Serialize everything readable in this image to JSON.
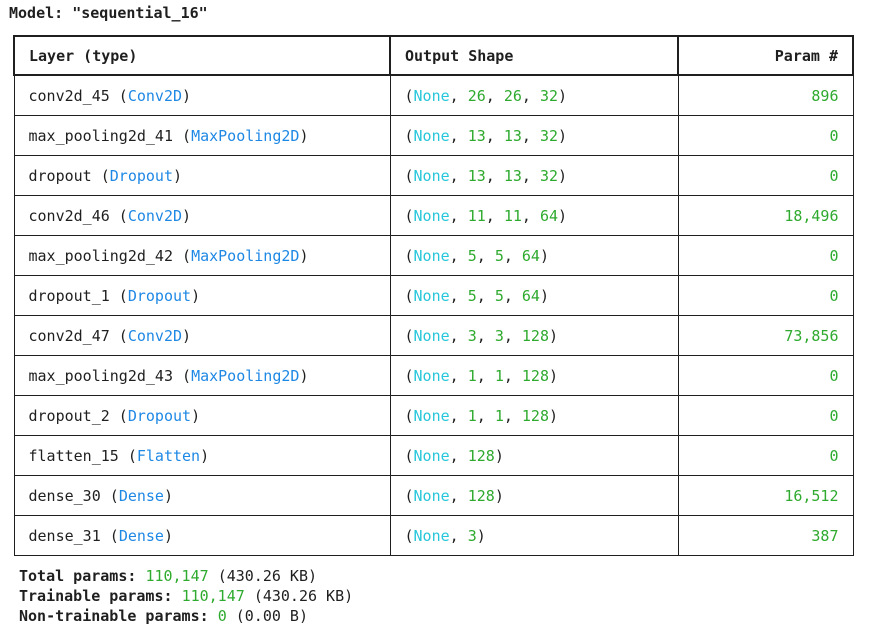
{
  "model": {
    "title": "Model: \"sequential_16\""
  },
  "table": {
    "headers": {
      "layer": "Layer (type)",
      "shape": "Output Shape",
      "params": "Param #"
    },
    "rows": [
      {
        "name": "conv2d_45",
        "type": "Conv2D",
        "shape": [
          "26",
          "26",
          "32"
        ],
        "params": "896"
      },
      {
        "name": "max_pooling2d_41",
        "type": "MaxPooling2D",
        "shape": [
          "13",
          "13",
          "32"
        ],
        "params": "0"
      },
      {
        "name": "dropout",
        "type": "Dropout",
        "shape": [
          "13",
          "13",
          "32"
        ],
        "params": "0"
      },
      {
        "name": "conv2d_46",
        "type": "Conv2D",
        "shape": [
          "11",
          "11",
          "64"
        ],
        "params": "18,496"
      },
      {
        "name": "max_pooling2d_42",
        "type": "MaxPooling2D",
        "shape": [
          "5",
          "5",
          "64"
        ],
        "params": "0"
      },
      {
        "name": "dropout_1",
        "type": "Dropout",
        "shape": [
          "5",
          "5",
          "64"
        ],
        "params": "0"
      },
      {
        "name": "conv2d_47",
        "type": "Conv2D",
        "shape": [
          "3",
          "3",
          "128"
        ],
        "params": "73,856"
      },
      {
        "name": "max_pooling2d_43",
        "type": "MaxPooling2D",
        "shape": [
          "1",
          "1",
          "128"
        ],
        "params": "0"
      },
      {
        "name": "dropout_2",
        "type": "Dropout",
        "shape": [
          "1",
          "1",
          "128"
        ],
        "params": "0"
      },
      {
        "name": "flatten_15",
        "type": "Flatten",
        "shape": [
          "128"
        ],
        "params": "0"
      },
      {
        "name": "dense_30",
        "type": "Dense",
        "shape": [
          "128"
        ],
        "params": "16,512"
      },
      {
        "name": "dense_31",
        "type": "Dense",
        "shape": [
          "3"
        ],
        "params": "387"
      }
    ]
  },
  "totals": {
    "total_label": "Total params:",
    "total_value": "110,147",
    "total_size": "(430.26 KB)",
    "trainable_label": "Trainable params:",
    "trainable_value": "110,147",
    "trainable_size": "(430.26 KB)",
    "nontrainable_label": "Non-trainable params:",
    "nontrainable_value": "0",
    "nontrainable_size": "(0.00 B)"
  },
  "colors": {
    "type": "#1e88e5",
    "none": "#26c6da",
    "number": "#2eaa2e"
  }
}
